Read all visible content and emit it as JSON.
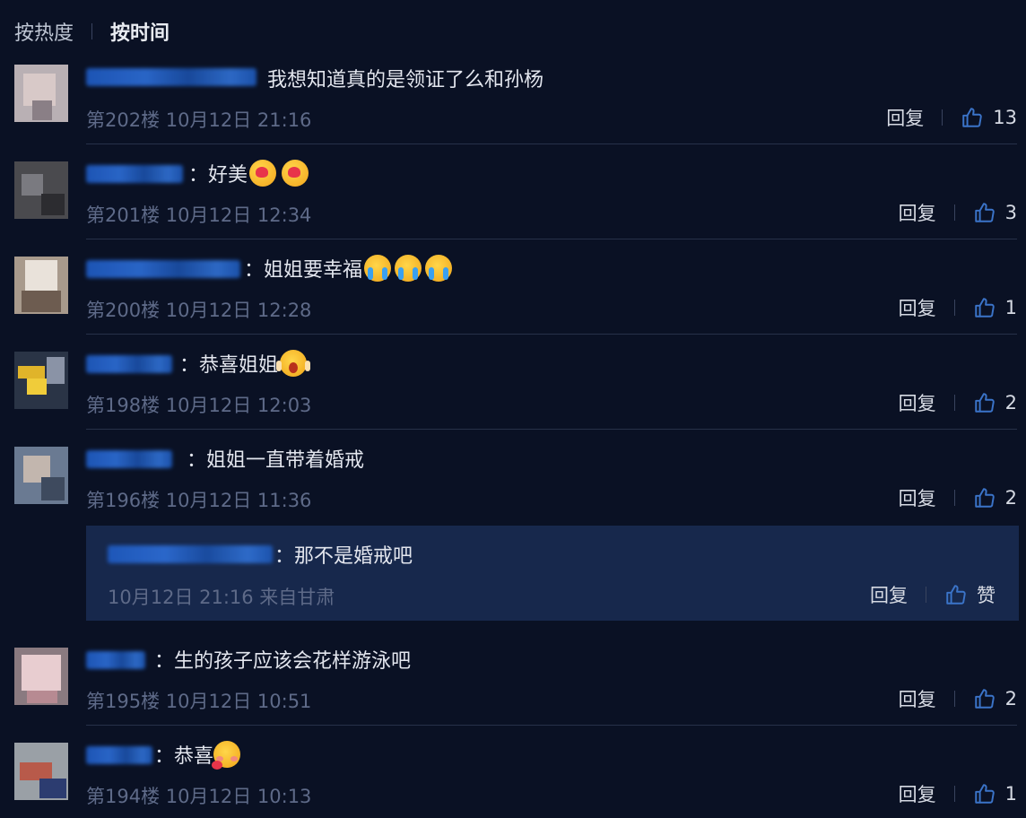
{
  "sort": {
    "hot": "按热度",
    "time": "按时间"
  },
  "actions": {
    "reply": "回复",
    "like_word": "赞"
  },
  "comments": [
    {
      "text": "我想知道真的是领证了么和孙杨",
      "floor": "第202楼",
      "date": "10月12日 21:16",
      "likes": "13"
    },
    {
      "text": "：好美",
      "floor": "第201楼",
      "date": "10月12日 12:34",
      "likes": "3"
    },
    {
      "text": "：姐姐要幸福",
      "floor": "第200楼",
      "date": "10月12日 12:28",
      "likes": "1"
    },
    {
      "text": "：恭喜姐姐",
      "floor": "第198楼",
      "date": "10月12日 12:03",
      "likes": "2"
    },
    {
      "text": "：姐姐一直带着婚戒",
      "floor": "第196楼",
      "date": "10月12日 11:36",
      "likes": "2"
    },
    {
      "text": "：生的孩子应该会花样游泳吧",
      "floor": "第195楼",
      "date": "10月12日 10:51",
      "likes": "2"
    },
    {
      "text": "：恭喜",
      "floor": "第194楼",
      "date": "10月12日 10:13",
      "likes": "1"
    }
  ],
  "reply": {
    "text": "：那不是婚戒吧",
    "meta": "10月12日 21:16 来自甘肃"
  },
  "emojis": {
    "c1": [
      "kiss-heart-emoji",
      "kiss-heart-emoji"
    ],
    "c2": [
      "crying-emoji",
      "crying-emoji",
      "crying-emoji"
    ],
    "c3": [
      "screaming-emoji"
    ],
    "c6": [
      "blushing-emoji"
    ]
  },
  "colors": {
    "background": "#0a1124",
    "reply_bg": "#17284c",
    "meta": "#5e6a88",
    "name_blur": "#1f5cc4"
  }
}
